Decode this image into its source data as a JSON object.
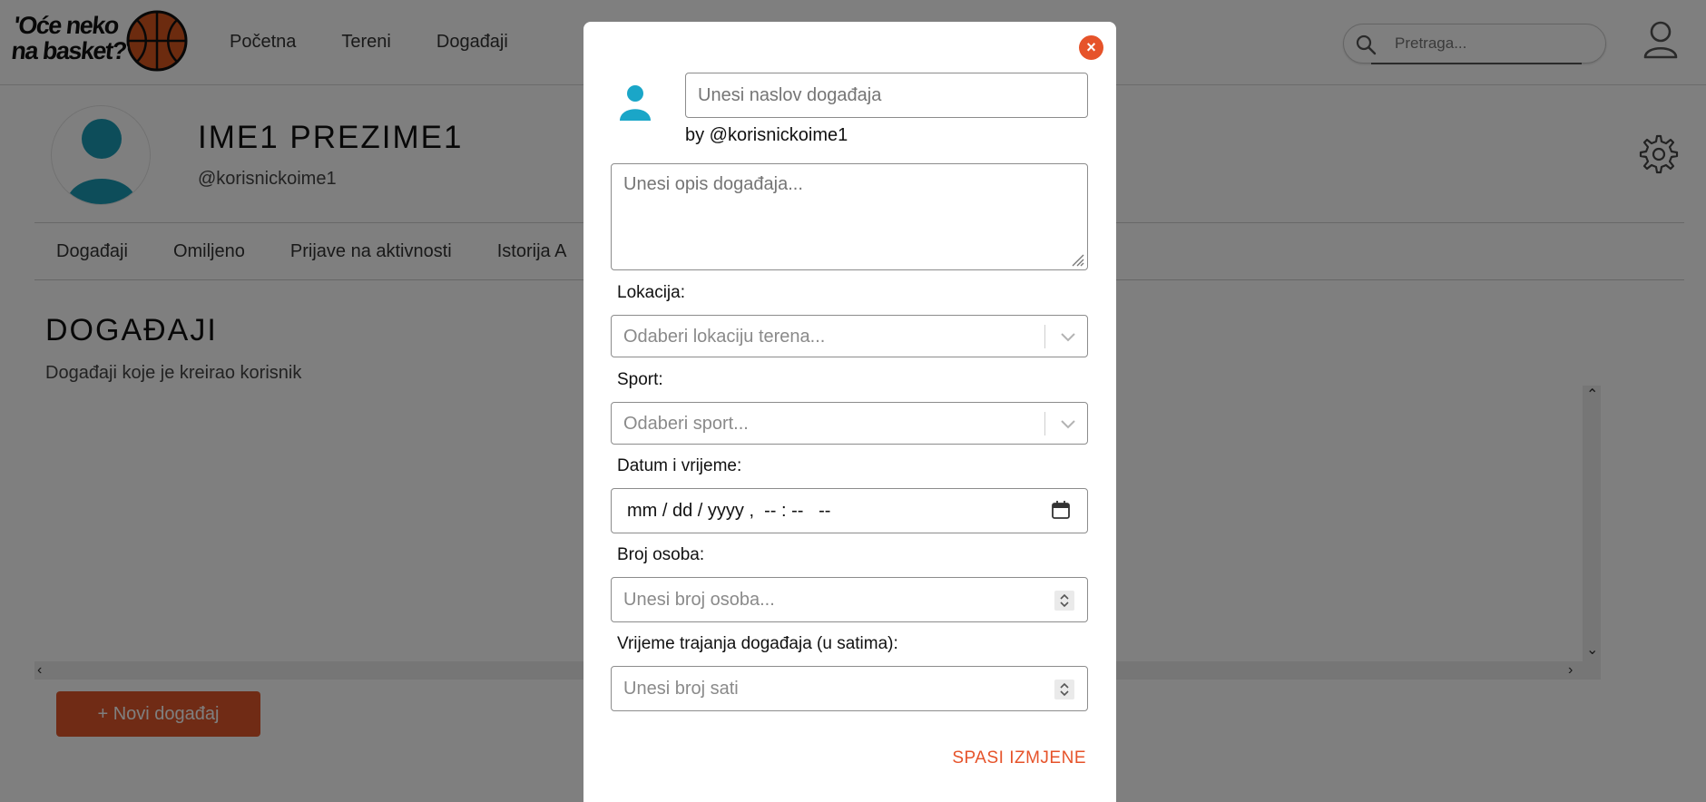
{
  "header": {
    "logo_text_line1": "'Oće neko",
    "logo_text_line2": "na basket?",
    "nav": [
      "Početna",
      "Tereni",
      "Događaji"
    ],
    "search_placeholder": "Pretraga..."
  },
  "profile": {
    "name": "IME1 PREZIME1",
    "username": "@korisnickoime1"
  },
  "tabs": [
    "Događaji",
    "Omiljeno",
    "Prijave na aktivnosti",
    "Istorija A"
  ],
  "section": {
    "title": "DOGAĐAJI",
    "subtitle": "Događaji koje je kreirao korisnik"
  },
  "new_event_button": "+ Novi događaj",
  "modal": {
    "title_placeholder": "Unesi naslov događaja",
    "by": "by @korisnickoime1",
    "description_placeholder": "Unesi opis događaja...",
    "location_label": "Lokacija:",
    "location_placeholder": "Odaberi lokaciju terena...",
    "sport_label": "Sport:",
    "sport_placeholder": "Odaberi sport...",
    "datetime_label": "Datum i vrijeme:",
    "datetime_value": "mm / dd / yyyy ,  -- : --   --",
    "people_label": "Broj osoba:",
    "people_placeholder": "Unesi broj osoba...",
    "duration_label": "Vrijeme trajanja događaja (u satima):",
    "duration_placeholder": "Unesi broj sati",
    "save_label": "SPASI IZMJENE",
    "close_symbol": "×"
  },
  "colors": {
    "accent": "#e0572a",
    "avatar": "#1a9bb5",
    "overlay": "rgba(0,0,0,0.5)"
  },
  "icons": [
    "basketball-icon",
    "search-icon",
    "user-icon",
    "gear-icon",
    "close-icon",
    "chevron-down-icon",
    "calendar-icon",
    "spinner-icon"
  ]
}
